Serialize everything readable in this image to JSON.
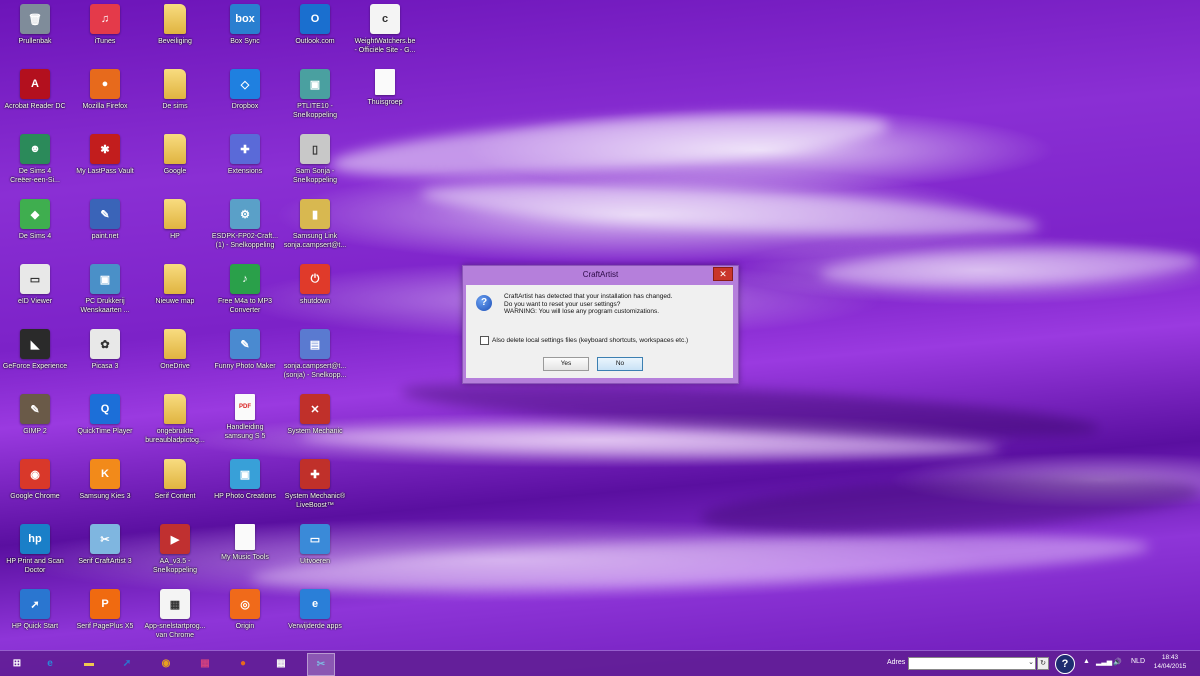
{
  "desktop": {
    "icons": [
      {
        "label": "Prullenbak",
        "glyph": "🗑",
        "color": "#7f8c9a",
        "kind": "app"
      },
      {
        "label": "Acrobat Reader DC",
        "glyph": "A",
        "color": "#b3101e",
        "kind": "app"
      },
      {
        "label": "De Sims 4\nCreëer-een-Si...",
        "glyph": "☻",
        "color": "#2b8a5a",
        "kind": "app"
      },
      {
        "label": "De Sims 4",
        "glyph": "◆",
        "color": "#3fae4f",
        "kind": "app"
      },
      {
        "label": "eID Viewer",
        "glyph": "▭",
        "color": "#e8e8e8",
        "kind": "app"
      },
      {
        "label": "GeForce Experience",
        "glyph": "◣",
        "color": "#2a2a2a",
        "kind": "app"
      },
      {
        "label": "GIMP 2",
        "glyph": "✎",
        "color": "#6a5a48",
        "kind": "app"
      },
      {
        "label": "Google Chrome",
        "glyph": "◉",
        "color": "#d9382a",
        "kind": "app"
      },
      {
        "label": "HP Print and Scan\nDoctor",
        "glyph": "hp",
        "color": "#1a7fc8",
        "kind": "app"
      },
      {
        "label": "HP Quick Start",
        "glyph": "➚",
        "color": "#2a76d0",
        "kind": "app"
      },
      {
        "label": "iTunes",
        "glyph": "♫",
        "color": "#e43a4a",
        "kind": "app"
      },
      {
        "label": "Mozilla Firefox",
        "glyph": "●",
        "color": "#e76a1c",
        "kind": "app"
      },
      {
        "label": "My LastPass Vault",
        "glyph": "✱",
        "color": "#c21d1d",
        "kind": "app"
      },
      {
        "label": "paint.net",
        "glyph": "✎",
        "color": "#3a64b8",
        "kind": "app"
      },
      {
        "label": "PC Drukkerij\nWenskaarten ...",
        "glyph": "▣",
        "color": "#4a90c8",
        "kind": "app"
      },
      {
        "label": "Picasa 3",
        "glyph": "✿",
        "color": "#e8e8e8",
        "kind": "app"
      },
      {
        "label": "QuickTime Player",
        "glyph": "Q",
        "color": "#1c6fd8",
        "kind": "app"
      },
      {
        "label": "Samsung Kies 3",
        "glyph": "K",
        "color": "#f28a1a",
        "kind": "app"
      },
      {
        "label": "Serif CraftArtist 3",
        "glyph": "✂",
        "color": "#7fb6e0",
        "kind": "app"
      },
      {
        "label": "Serif PagePlus X5",
        "glyph": "P",
        "color": "#f06a10",
        "kind": "app"
      },
      {
        "label": "Beveiliging",
        "glyph": "",
        "color": "",
        "kind": "folder"
      },
      {
        "label": "De sims",
        "glyph": "",
        "color": "",
        "kind": "folder"
      },
      {
        "label": "Google",
        "glyph": "",
        "color": "",
        "kind": "folder"
      },
      {
        "label": "HP",
        "glyph": "",
        "color": "",
        "kind": "folder"
      },
      {
        "label": "Nieuwe map",
        "glyph": "",
        "color": "",
        "kind": "folder"
      },
      {
        "label": "OneDrive",
        "glyph": "",
        "color": "",
        "kind": "folder"
      },
      {
        "label": "ongebruikte\nbureaubladpictog...",
        "glyph": "",
        "color": "",
        "kind": "folder"
      },
      {
        "label": "Serif Content",
        "glyph": "",
        "color": "",
        "kind": "folder"
      },
      {
        "label": "AA_v3.5 -\nSnelkoppeling",
        "glyph": "▶",
        "color": "#c03030",
        "kind": "app"
      },
      {
        "label": "App-snelstartprog...\nvan Chrome",
        "glyph": "▦",
        "color": "#f4f4f4",
        "kind": "app"
      },
      {
        "label": "Box Sync",
        "glyph": "box",
        "color": "#2a7fd0",
        "kind": "app"
      },
      {
        "label": "Dropbox",
        "glyph": "◇",
        "color": "#1f80e0",
        "kind": "app"
      },
      {
        "label": "Extensions",
        "glyph": "✚",
        "color": "#5a6ad8",
        "kind": "app"
      },
      {
        "label": "ESDPK-FP02-Craft...\n(1) - Snelkoppeling",
        "glyph": "⚙",
        "color": "#5aa0c8",
        "kind": "app"
      },
      {
        "label": "Free M4a to MP3\nConverter",
        "glyph": "♪",
        "color": "#2aa04a",
        "kind": "app"
      },
      {
        "label": "Funny Photo Maker",
        "glyph": "✎",
        "color": "#4a8ad0",
        "kind": "app"
      },
      {
        "label": "Handleiding\nsamsung S 5",
        "glyph": "PDF",
        "color": "#d92020",
        "kind": "doc"
      },
      {
        "label": "HP Photo Creations",
        "glyph": "▣",
        "color": "#38a0d8",
        "kind": "app"
      },
      {
        "label": "My Music Tools",
        "glyph": "",
        "color": "",
        "kind": "doc"
      },
      {
        "label": "Origin",
        "glyph": "◎",
        "color": "#f06a1a",
        "kind": "app"
      },
      {
        "label": "Outlook.com",
        "glyph": "O",
        "color": "#1a6fcf",
        "kind": "app"
      },
      {
        "label": "PTLITE10 -\nSnelkoppeling",
        "glyph": "▣",
        "color": "#4aa0a0",
        "kind": "app"
      },
      {
        "label": "Sam Sonja -\nSnelkoppeling",
        "glyph": "▯",
        "color": "#c8c8c8",
        "kind": "app"
      },
      {
        "label": "Samsung Link\nsonja.campsert@t...",
        "glyph": "▮",
        "color": "#d8b850",
        "kind": "app"
      },
      {
        "label": "shutdown",
        "glyph": "⏻",
        "color": "#e03a2a",
        "kind": "app"
      },
      {
        "label": "sonja.campsert@t...\n(sonja) - Snelkopp...",
        "glyph": "▤",
        "color": "#5a7ad0",
        "kind": "app"
      },
      {
        "label": "System Mechanic",
        "glyph": "✕",
        "color": "#c0302a",
        "kind": "app"
      },
      {
        "label": "System Mechanic®\nLiveBoost™",
        "glyph": "✚",
        "color": "#c0302a",
        "kind": "app"
      },
      {
        "label": "Uitvoeren",
        "glyph": "▭",
        "color": "#3a8ad8",
        "kind": "app"
      },
      {
        "label": "Verwijderde apps",
        "glyph": "e",
        "color": "#2a7fd8",
        "kind": "app"
      },
      {
        "label": "WeightWatchers.be\n- Officiële Site - G...",
        "glyph": "c",
        "color": "#f4f4f4",
        "kind": "app"
      },
      {
        "label": "Thuisgroep",
        "glyph": "",
        "color": "",
        "kind": "doc"
      }
    ]
  },
  "dialog": {
    "title": "CraftArtist",
    "close_glyph": "✕",
    "icon_glyph": "?",
    "message_line1": "CraftArtist has detected that your installation has changed.",
    "message_line2": "Do you want to reset your user settings?",
    "message_line3": "WARNING: You will lose any program customizations.",
    "checkbox_label": "Also delete local settings files (keyboard shortcuts, workspaces etc.)",
    "checkbox_checked": false,
    "yes_label": "Yes",
    "no_label": "No"
  },
  "taskbar": {
    "items": [
      {
        "name": "start-button",
        "glyph": "⊞",
        "color": "#ffffff"
      },
      {
        "name": "internet-explorer",
        "glyph": "e",
        "color": "#2a8ad8"
      },
      {
        "name": "file-explorer",
        "glyph": "▬",
        "color": "#f0c850"
      },
      {
        "name": "hp-quick-start",
        "glyph": "➚",
        "color": "#2a76d0"
      },
      {
        "name": "media-app",
        "glyph": "◉",
        "color": "#e8a020"
      },
      {
        "name": "photo-app",
        "glyph": "▦",
        "color": "#d04080"
      },
      {
        "name": "firefox",
        "glyph": "●",
        "color": "#e76a1c"
      },
      {
        "name": "chrome-apps",
        "glyph": "▦",
        "color": "#f4f4f4"
      },
      {
        "name": "craftartist",
        "glyph": "✂",
        "color": "#7fb6e0"
      }
    ],
    "address_label": "Adres",
    "address_value": "",
    "help_glyph": "?",
    "tray_up": "▲",
    "tray_network": "▂▃▅",
    "tray_volume": "🔊",
    "tray_flag": "⚑",
    "language": "NLD",
    "time": "18:43",
    "date": "14/04/2015"
  }
}
